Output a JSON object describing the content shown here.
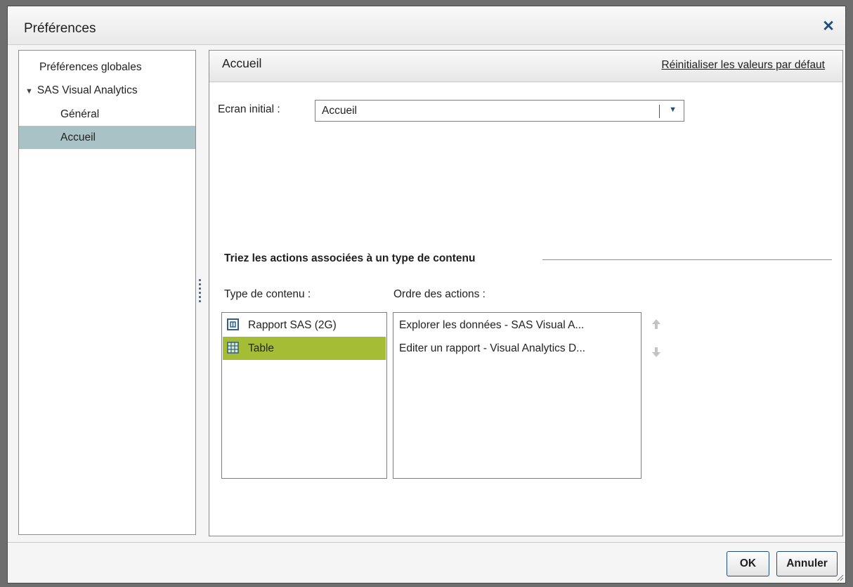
{
  "dialog": {
    "title": "Préférences",
    "close_icon": "close-icon",
    "accent_color": "#1d4f7c"
  },
  "nav": {
    "items": [
      {
        "label": "Préférences globales",
        "expanded": null,
        "selected": false
      },
      {
        "label": "SAS Visual Analytics",
        "expanded": true,
        "selected": false
      },
      {
        "label": "Général",
        "selected": false
      },
      {
        "label": "Accueil",
        "selected": true
      }
    ],
    "selected_color": "#a9c2c6"
  },
  "content": {
    "title": "Accueil",
    "reset_link": "Réinitialiser les valeurs par défaut",
    "initial_screen": {
      "label": "Ecran initial :",
      "value": "Accueil",
      "dropdown_icon": "chevron-down-icon"
    },
    "sort_group": {
      "title": "Triez les actions associées à un type de contenu",
      "content_type_label": "Type de contenu :",
      "action_order_label": "Ordre des actions :",
      "content_types": [
        {
          "label": "Rapport SAS (2G)",
          "icon": "report-icon",
          "selected": false
        },
        {
          "label": "Table",
          "icon": "table-icon",
          "selected": true
        }
      ],
      "selected_color": "#a4bd34",
      "actions": [
        {
          "label": "Explorer les données - SAS Visual A..."
        },
        {
          "label": "Editer un rapport - Visual Analytics D..."
        }
      ],
      "move_up_icon": "arrow-up-icon",
      "move_down_icon": "arrow-down-icon"
    }
  },
  "footer": {
    "ok_label": "OK",
    "cancel_label": "Annuler"
  }
}
